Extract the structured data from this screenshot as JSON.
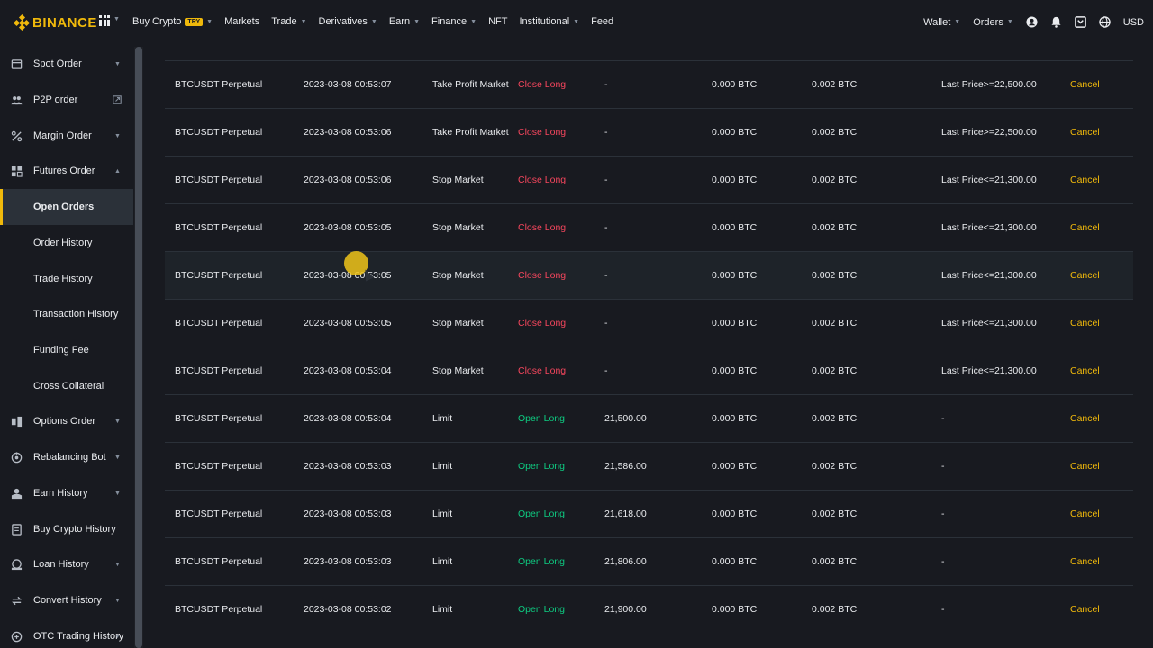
{
  "brand": {
    "name": "BINANCE"
  },
  "nav": {
    "items": [
      {
        "label": "Buy Crypto",
        "badge": "TRY",
        "caret": true
      },
      {
        "label": "Markets",
        "caret": false
      },
      {
        "label": "Trade",
        "caret": true
      },
      {
        "label": "Derivatives",
        "caret": true
      },
      {
        "label": "Earn",
        "caret": true
      },
      {
        "label": "Finance",
        "caret": true
      },
      {
        "label": "NFT",
        "caret": false
      },
      {
        "label": "Institutional",
        "caret": true
      },
      {
        "label": "Feed",
        "caret": false
      }
    ],
    "right": {
      "wallet": "Wallet",
      "orders": "Orders",
      "currency": "USD"
    }
  },
  "sidebar": {
    "items": [
      {
        "label": "Spot Order",
        "icon": "spot-order-icon",
        "caret": true
      },
      {
        "label": "P2P order",
        "icon": "p2p-icon",
        "external": true
      },
      {
        "label": "Margin Order",
        "icon": "margin-icon",
        "caret": true
      },
      {
        "label": "Futures Order",
        "icon": "futures-icon",
        "caret": true
      },
      {
        "label": "Open Orders",
        "sub": true,
        "active": true
      },
      {
        "label": "Order History",
        "sub": true
      },
      {
        "label": "Trade History",
        "sub": true
      },
      {
        "label": "Transaction History",
        "sub": true
      },
      {
        "label": "Funding Fee",
        "sub": true
      },
      {
        "label": "Cross Collateral",
        "sub": true
      },
      {
        "label": "Options Order",
        "icon": "options-icon",
        "caret": true
      },
      {
        "label": "Rebalancing Bot",
        "icon": "bot-icon",
        "caret": true
      },
      {
        "label": "Earn History",
        "icon": "earn-icon",
        "caret": true
      },
      {
        "label": "Buy Crypto History",
        "icon": "buy-crypto-icon",
        "caret": false
      },
      {
        "label": "Loan History",
        "icon": "loan-icon",
        "caret": true
      },
      {
        "label": "Convert History",
        "icon": "convert-icon",
        "caret": true
      },
      {
        "label": "OTC Trading History",
        "icon": "otc-icon",
        "caret": true
      }
    ]
  },
  "orders": [
    {
      "symbol": "BTCUSDT Perpetual",
      "time": "2023-03-08 00:53:07",
      "type": "Take Profit Market",
      "side": "Close Long",
      "side_color": "red",
      "price": "-",
      "amount": "0.000 BTC",
      "filled": "0.002 BTC",
      "trigger": "Last Price>=22,500.00",
      "action": "Cancel"
    },
    {
      "symbol": "BTCUSDT Perpetual",
      "time": "2023-03-08 00:53:06",
      "type": "Take Profit Market",
      "side": "Close Long",
      "side_color": "red",
      "price": "-",
      "amount": "0.000 BTC",
      "filled": "0.002 BTC",
      "trigger": "Last Price>=22,500.00",
      "action": "Cancel"
    },
    {
      "symbol": "BTCUSDT Perpetual",
      "time": "2023-03-08 00:53:06",
      "type": "Stop Market",
      "side": "Close Long",
      "side_color": "red",
      "price": "-",
      "amount": "0.000 BTC",
      "filled": "0.002 BTC",
      "trigger": "Last Price<=21,300.00",
      "action": "Cancel"
    },
    {
      "symbol": "BTCUSDT Perpetual",
      "time": "2023-03-08 00:53:05",
      "type": "Stop Market",
      "side": "Close Long",
      "side_color": "red",
      "price": "-",
      "amount": "0.000 BTC",
      "filled": "0.002 BTC",
      "trigger": "Last Price<=21,300.00",
      "action": "Cancel"
    },
    {
      "symbol": "BTCUSDT Perpetual",
      "time": "2023-03-08 00:53:05",
      "type": "Stop Market",
      "side": "Close Long",
      "side_color": "red",
      "price": "-",
      "amount": "0.000 BTC",
      "filled": "0.002 BTC",
      "trigger": "Last Price<=21,300.00",
      "action": "Cancel",
      "hover": true
    },
    {
      "symbol": "BTCUSDT Perpetual",
      "time": "2023-03-08 00:53:05",
      "type": "Stop Market",
      "side": "Close Long",
      "side_color": "red",
      "price": "-",
      "amount": "0.000 BTC",
      "filled": "0.002 BTC",
      "trigger": "Last Price<=21,300.00",
      "action": "Cancel"
    },
    {
      "symbol": "BTCUSDT Perpetual",
      "time": "2023-03-08 00:53:04",
      "type": "Stop Market",
      "side": "Close Long",
      "side_color": "red",
      "price": "-",
      "amount": "0.000 BTC",
      "filled": "0.002 BTC",
      "trigger": "Last Price<=21,300.00",
      "action": "Cancel"
    },
    {
      "symbol": "BTCUSDT Perpetual",
      "time": "2023-03-08 00:53:04",
      "type": "Limit",
      "side": "Open Long",
      "side_color": "green",
      "price": "21,500.00",
      "amount": "0.000 BTC",
      "filled": "0.002 BTC",
      "trigger": "-",
      "action": "Cancel"
    },
    {
      "symbol": "BTCUSDT Perpetual",
      "time": "2023-03-08 00:53:03",
      "type": "Limit",
      "side": "Open Long",
      "side_color": "green",
      "price": "21,586.00",
      "amount": "0.000 BTC",
      "filled": "0.002 BTC",
      "trigger": "-",
      "action": "Cancel"
    },
    {
      "symbol": "BTCUSDT Perpetual",
      "time": "2023-03-08 00:53:03",
      "type": "Limit",
      "side": "Open Long",
      "side_color": "green",
      "price": "21,618.00",
      "amount": "0.000 BTC",
      "filled": "0.002 BTC",
      "trigger": "-",
      "action": "Cancel"
    },
    {
      "symbol": "BTCUSDT Perpetual",
      "time": "2023-03-08 00:53:03",
      "type": "Limit",
      "side": "Open Long",
      "side_color": "green",
      "price": "21,806.00",
      "amount": "0.000 BTC",
      "filled": "0.002 BTC",
      "trigger": "-",
      "action": "Cancel"
    },
    {
      "symbol": "BTCUSDT Perpetual",
      "time": "2023-03-08 00:53:02",
      "type": "Limit",
      "side": "Open Long",
      "side_color": "green",
      "price": "21,900.00",
      "amount": "0.000 BTC",
      "filled": "0.002 BTC",
      "trigger": "-",
      "action": "Cancel"
    }
  ],
  "colors": {
    "accent": "#f0b90b",
    "sell": "#f6465d",
    "buy": "#0ecb81",
    "bg": "#181a20"
  }
}
